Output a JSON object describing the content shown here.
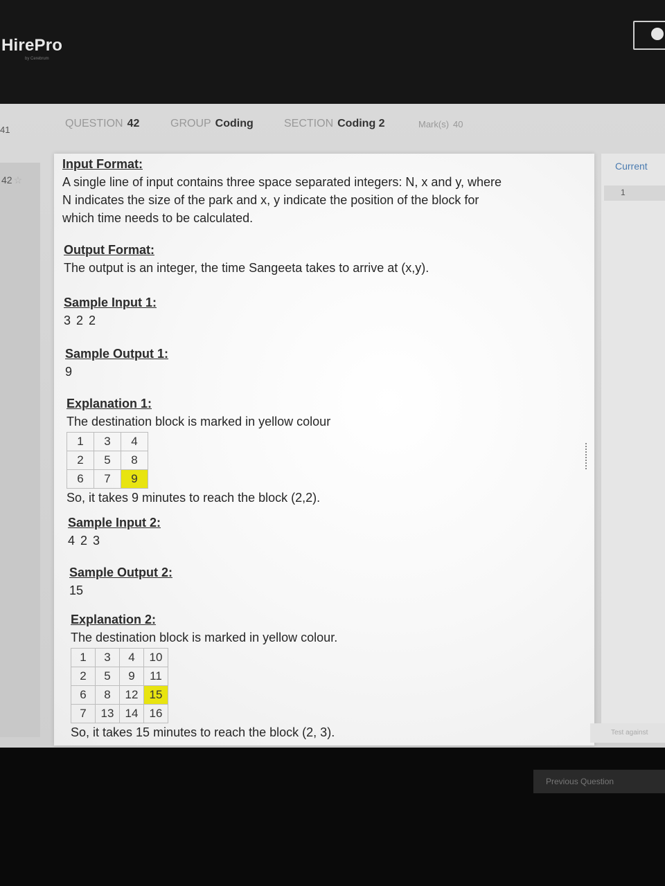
{
  "header": {
    "brand": "HirePro",
    "brand_sub": "by Cerebrum"
  },
  "prev_question_number": "41",
  "meta": {
    "question_label": "QUESTION",
    "question_value": "42",
    "group_label": "GROUP",
    "group_value": "Coding",
    "section_label": "SECTION",
    "section_value": "Coding 2",
    "marks_label": "Mark(s)",
    "marks_value": "40"
  },
  "sidebar": {
    "current_question": "42"
  },
  "right_panel": {
    "heading": "Current",
    "line_number": "1",
    "test_button": "Test against"
  },
  "bottom": {
    "button_label": "Previous Question"
  },
  "problem": {
    "input_format_heading": "Input Format:",
    "input_format_lines": [
      "A single line of input contains three space separated integers: N, x and y, where",
      "N indicates the size of the park and x, y indicate the position of the block for",
      "which time needs to be calculated."
    ],
    "output_format_heading": "Output Format:",
    "output_format_text": "The output is an integer, the time Sangeeta takes to arrive at (x,y).",
    "sample_input_1_heading": "Sample Input 1:",
    "sample_input_1": "3 2 2",
    "sample_output_1_heading": "Sample Output 1:",
    "sample_output_1": "9",
    "explanation_1_heading": "Explanation 1:",
    "explanation_1_text": "The destination block is marked in yellow colour",
    "grid_1": [
      [
        "1",
        "3",
        "4"
      ],
      [
        "2",
        "5",
        "8"
      ],
      [
        "6",
        "7",
        "9"
      ]
    ],
    "explanation_1_result": "So, it takes 9 minutes to reach the block (2,2).",
    "sample_input_2_heading": "Sample Input 2:",
    "sample_input_2": "4 2 3",
    "sample_output_2_heading": "Sample Output 2:",
    "sample_output_2": "15",
    "explanation_2_heading": "Explanation 2:",
    "explanation_2_text": "The destination block is marked in yellow colour.",
    "grid_2": [
      [
        "1",
        "3",
        "4",
        "10"
      ],
      [
        "2",
        "5",
        "9",
        "11"
      ],
      [
        "6",
        "8",
        "12",
        "15"
      ],
      [
        "7",
        "13",
        "14",
        "16"
      ]
    ],
    "explanation_2_result": "So, it takes 15 minutes to reach the block (2, 3).",
    "highlight_color": "#e8e410"
  }
}
